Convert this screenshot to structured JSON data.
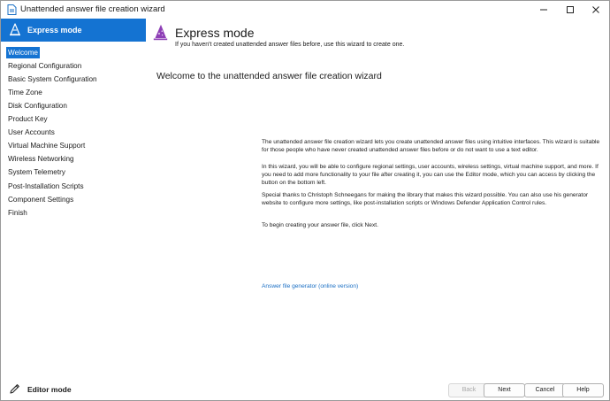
{
  "window": {
    "title": "Unattended answer file creation wizard"
  },
  "sidebar": {
    "mode_label": "Express mode",
    "items": [
      {
        "label": "Welcome"
      },
      {
        "label": "Regional Configuration"
      },
      {
        "label": "Basic System Configuration"
      },
      {
        "label": "Time Zone"
      },
      {
        "label": "Disk Configuration"
      },
      {
        "label": "Product Key"
      },
      {
        "label": "User Accounts"
      },
      {
        "label": "Virtual Machine Support"
      },
      {
        "label": "Wireless Networking"
      },
      {
        "label": "System Telemetry"
      },
      {
        "label": "Post-Installation Scripts"
      },
      {
        "label": "Component Settings"
      },
      {
        "label": "Finish"
      }
    ],
    "active_item": "Welcome",
    "editor_mode_label": "Editor mode"
  },
  "header": {
    "title": "Express mode",
    "subtitle": "If you haven't created unattended answer files before, use this wizard to create one."
  },
  "main": {
    "heading": "Welcome to the unattended answer file creation wizard",
    "paragraphs": [
      "The unattended answer file creation wizard lets you create unattended answer files using intuitive interfaces. This wizard is suitable for those people who have never created unattended answer files before or do not want to use a text editor.",
      "In this wizard, you will be able to configure regional settings, user accounts, wireless settings, virtual machine support, and more. If you need to add more functionality to your file after creating it, you can use the Editor mode, which you can access by clicking the button on the bottom left.",
      "Special thanks to Christoph Schneegans for making the library that makes this wizard possible. You can also use his generator website to configure more settings, like post-installation scripts or Windows Defender Application Control rules.",
      "To begin creating your answer file, click Next."
    ],
    "link": "Answer file generator (online version)"
  },
  "footer": {
    "back": "Back",
    "next": "Next",
    "cancel": "Cancel",
    "help": "Help",
    "back_enabled": false
  },
  "colors": {
    "accent": "#1473d2",
    "wizard_icon": "#8e3fb6",
    "link": "#1a6fc4"
  },
  "icons": {
    "app": "document-icon",
    "mode": "wizard-hat-icon",
    "header": "wizard-hat-icon",
    "editor": "pencil-icon",
    "minimize": "minimize-icon",
    "maximize": "maximize-icon",
    "close": "close-icon"
  }
}
